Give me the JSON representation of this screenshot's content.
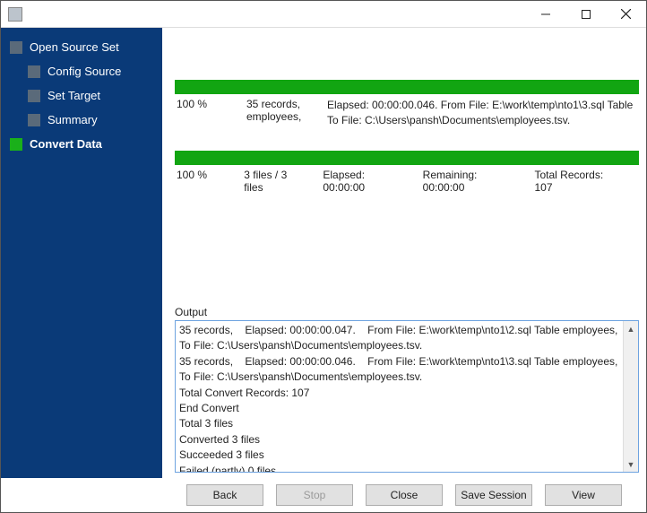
{
  "sidebar": {
    "items": [
      {
        "label": "Open Source Set",
        "sub": false,
        "active": false
      },
      {
        "label": "Config Source",
        "sub": true,
        "active": false
      },
      {
        "label": "Set Target",
        "sub": true,
        "active": false
      },
      {
        "label": "Summary",
        "sub": true,
        "active": false
      },
      {
        "label": "Convert Data",
        "sub": false,
        "active": true
      }
    ]
  },
  "progress1": {
    "percent": "100 %",
    "col2": "35 records, employees,",
    "details": "Elapsed: 00:00:00.046.    From File: E:\\work\\temp\\nto1\\3.sql Table\nTo File: C:\\Users\\pansh\\Documents\\employees.tsv."
  },
  "progress2": {
    "percent": "100 %",
    "files": "3 files / 3 files",
    "elapsed": "Elapsed: 00:00:00",
    "remaining": "Remaining: 00:00:00",
    "total": "Total Records: 107"
  },
  "output": {
    "label": "Output",
    "text": "35 records,    Elapsed: 00:00:00.047.    From File: E:\\work\\temp\\nto1\\2.sql Table employees,    To File: C:\\Users\\pansh\\Documents\\employees.tsv.\n35 records,    Elapsed: 00:00:00.046.    From File: E:\\work\\temp\\nto1\\3.sql Table employees,    To File: C:\\Users\\pansh\\Documents\\employees.tsv.\nTotal Convert Records: 107\nEnd Convert\nTotal 3 files\nConverted 3 files\nSucceeded 3 files\nFailed (partly) 0 files"
  },
  "buttons": {
    "back": "Back",
    "stop": "Stop",
    "close": "Close",
    "save": "Save Session",
    "view": "View"
  }
}
